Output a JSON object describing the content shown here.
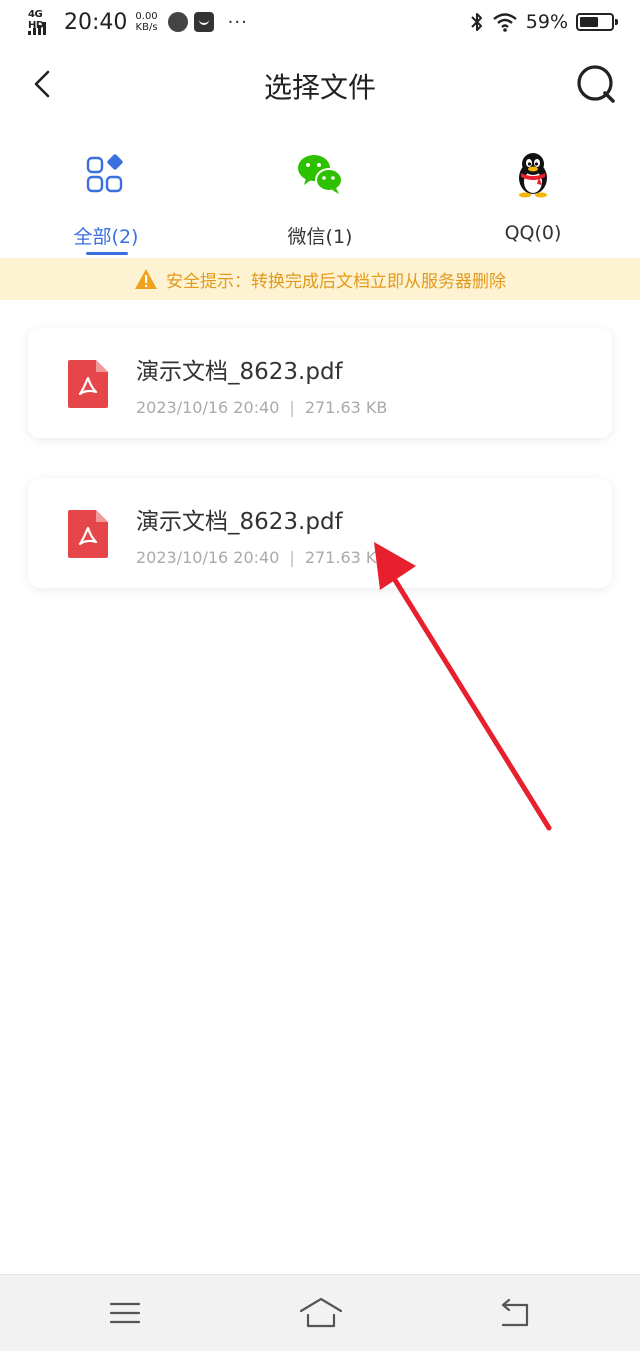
{
  "status_bar": {
    "network": "4G HD",
    "time": "20:40",
    "speed_value": "0.00",
    "speed_unit": "KB/s",
    "more": "···",
    "battery_percent": "59%",
    "battery_level": 0.59
  },
  "header": {
    "title": "选择文件"
  },
  "tabs": [
    {
      "label": "全部(2)",
      "icon": "all-files-grid-icon",
      "active": true
    },
    {
      "label": "微信(1)",
      "icon": "wechat-icon",
      "active": false
    },
    {
      "label": "QQ(0)",
      "icon": "qq-penguin-icon",
      "active": false
    }
  ],
  "notice": {
    "icon": "warning-icon",
    "text": "安全提示：转换完成后文档立即从服务器删除"
  },
  "files": [
    {
      "name": "演示文档_8623.pdf",
      "date": "2023/10/16 20:40",
      "separator": "|",
      "size": "271.63 KB",
      "icon": "pdf-file-icon"
    },
    {
      "name": "演示文档_8623.pdf",
      "date": "2023/10/16 20:40",
      "separator": "|",
      "size": "271.63 KB",
      "icon": "pdf-file-icon"
    }
  ],
  "colors": {
    "accent": "#3a6fe0",
    "notice_bg": "#fdf3d2",
    "notice_text": "#e39a1b",
    "pdf_red": "#e5464a",
    "annotation_arrow": "#e8202e"
  },
  "navbar": {
    "items": [
      "menu-icon",
      "home-icon",
      "back-icon"
    ]
  }
}
